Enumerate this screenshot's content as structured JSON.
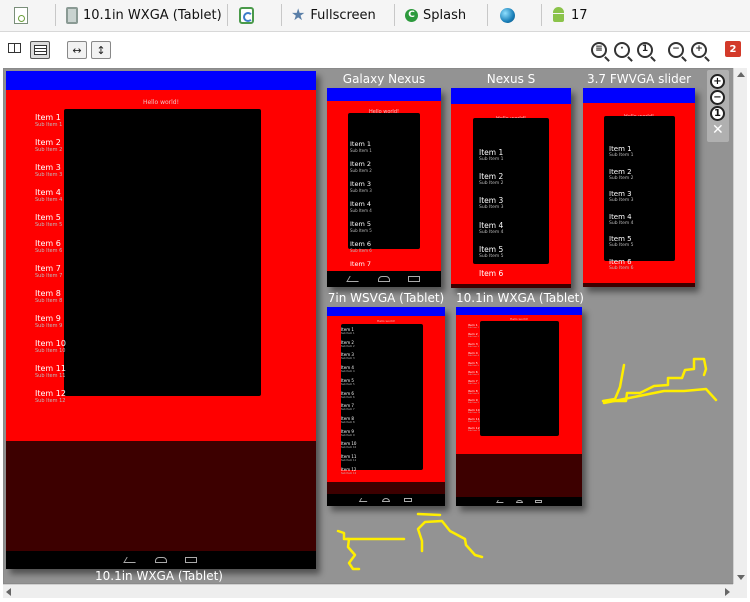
{
  "toolbar": {
    "config_label": "",
    "device_label": "10.1in WXGA (Tablet)",
    "orientation_label": "",
    "theme_label": "Fullscreen",
    "activity_label": "Splash",
    "locale_label": "",
    "api_label": "17",
    "icons": [
      "document-icon",
      "tablet-icon",
      "rotate-icon",
      "star-icon",
      "splash-icon",
      "globe-icon",
      "android-icon"
    ]
  },
  "row2": {
    "zoom_buttons": [
      "zoom-to-fit-icon",
      "zoom-actual-icon",
      "zoom-100-icon",
      "zoom-out-icon",
      "zoom-in-icon"
    ],
    "zoom_100_text": "1",
    "badge_count": "2"
  },
  "palette": {
    "zoom_in": "+",
    "zoom_out": "−",
    "zoom_reset": "1",
    "close": "✕"
  },
  "devices": {
    "main_label": "10.1in WXGA (Tablet)",
    "galaxy_label": "Galaxy Nexus",
    "nexus_s_label": "Nexus S",
    "fwvga_label": "3.7 FWVGA slider",
    "wsvga_label": "7in WSVGA (Tablet)",
    "wxga_label": "10.1in WXGA (Tablet)"
  },
  "hello_text": "Hello world!",
  "items": [
    {
      "title": "Item 1",
      "sub": "Sub Item 1"
    },
    {
      "title": "Item 2",
      "sub": "Sub Item 2"
    },
    {
      "title": "Item 3",
      "sub": "Sub Item 3"
    },
    {
      "title": "Item 4",
      "sub": "Sub Item 4"
    },
    {
      "title": "Item 5",
      "sub": "Sub Item 5"
    },
    {
      "title": "Item 6",
      "sub": "Sub Item 6"
    },
    {
      "title": "Item 7",
      "sub": "Sub Item 7"
    },
    {
      "title": "Item 8",
      "sub": "Sub Item 8"
    },
    {
      "title": "Item 9",
      "sub": "Sub Item 9"
    },
    {
      "title": "Item 10",
      "sub": "Sub Item 10"
    },
    {
      "title": "Item 11",
      "sub": "Sub Item 11"
    },
    {
      "title": "Item 12",
      "sub": "Sub Item 12"
    }
  ],
  "colors": {
    "activity_bg": "#ff0000",
    "action_bar": "#0000ff",
    "list_bg": "#000000",
    "canvas_bg": "#939393",
    "scribble": "#ffee00"
  }
}
